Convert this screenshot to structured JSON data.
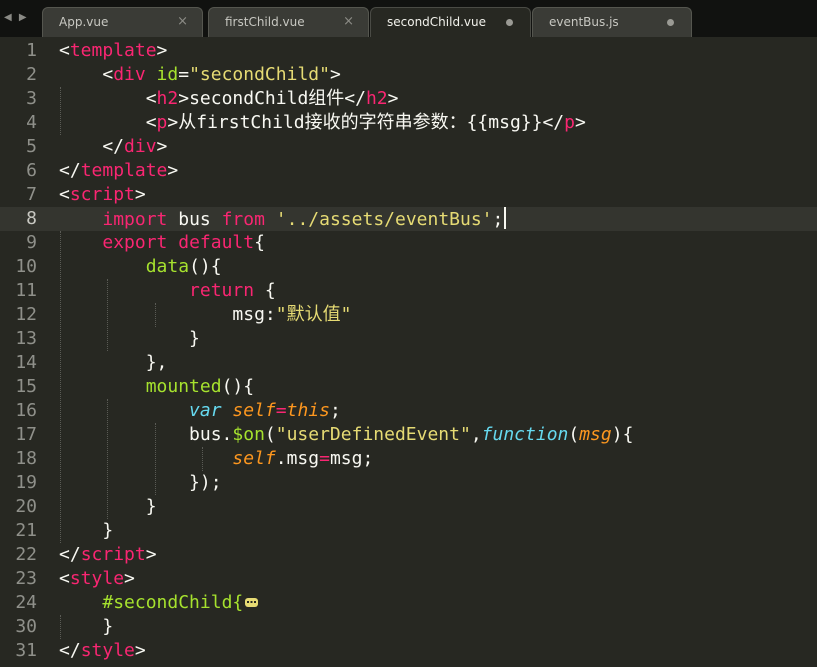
{
  "tabs": [
    {
      "label": "App.vue",
      "state": "close"
    },
    {
      "label": "firstChild.vue",
      "state": "close"
    },
    {
      "label": "secondChild.vue",
      "state": "modified"
    },
    {
      "label": "eventBus.js",
      "state": "modified"
    }
  ],
  "tab_close_glyph": "×",
  "nav_arrows": "◀ ▶",
  "lines": [
    {
      "no": "1",
      "tokens": [
        {
          "t": "<"
        },
        {
          "t": "template",
          "c": "t-tag"
        },
        {
          "t": ">"
        }
      ]
    },
    {
      "no": "2",
      "tokens": [
        {
          "t": "    <"
        },
        {
          "t": "div",
          "c": "t-tag"
        },
        {
          "t": " "
        },
        {
          "t": "id",
          "c": "t-attr"
        },
        {
          "t": "="
        },
        {
          "t": "\"secondChild\"",
          "c": "t-str"
        },
        {
          "t": ">"
        }
      ]
    },
    {
      "no": "3",
      "tokens": [
        {
          "t": "        <"
        },
        {
          "t": "h2",
          "c": "t-tag"
        },
        {
          "t": ">secondChild组件</"
        },
        {
          "t": "h2",
          "c": "t-tag"
        },
        {
          "t": ">"
        }
      ]
    },
    {
      "no": "4",
      "tokens": [
        {
          "t": "        <"
        },
        {
          "t": "p",
          "c": "t-tag"
        },
        {
          "t": ">从firstChild接收的字符串参数：{{msg}}</"
        },
        {
          "t": "p",
          "c": "t-tag"
        },
        {
          "t": ">"
        }
      ]
    },
    {
      "no": "5",
      "tokens": [
        {
          "t": "    </"
        },
        {
          "t": "div",
          "c": "t-tag"
        },
        {
          "t": ">"
        }
      ]
    },
    {
      "no": "6",
      "tokens": [
        {
          "t": "</"
        },
        {
          "t": "template",
          "c": "t-tag"
        },
        {
          "t": ">"
        }
      ]
    },
    {
      "no": "7",
      "tokens": [
        {
          "t": "<"
        },
        {
          "t": "script",
          "c": "t-tag"
        },
        {
          "t": ">"
        }
      ]
    },
    {
      "no": "8",
      "tokens": [
        {
          "t": "    "
        },
        {
          "t": "import",
          "c": "t-kw"
        },
        {
          "t": " bus "
        },
        {
          "t": "from",
          "c": "t-kw"
        },
        {
          "t": " "
        },
        {
          "t": "'../assets/eventBus'",
          "c": "t-str"
        },
        {
          "t": ";"
        }
      ],
      "current": true
    },
    {
      "no": "9",
      "tokens": [
        {
          "t": "    "
        },
        {
          "t": "export",
          "c": "t-kw"
        },
        {
          "t": " "
        },
        {
          "t": "default",
          "c": "t-kw"
        },
        {
          "t": "{"
        }
      ]
    },
    {
      "no": "10",
      "tokens": [
        {
          "t": "        "
        },
        {
          "t": "data",
          "c": "t-fn"
        },
        {
          "t": "(){"
        }
      ]
    },
    {
      "no": "11",
      "tokens": [
        {
          "t": "            "
        },
        {
          "t": "return",
          "c": "t-kw"
        },
        {
          "t": " {"
        }
      ]
    },
    {
      "no": "12",
      "tokens": [
        {
          "t": "                msg:"
        },
        {
          "t": "\"默认值\"",
          "c": "t-str"
        }
      ]
    },
    {
      "no": "13",
      "tokens": [
        {
          "t": "            }"
        }
      ]
    },
    {
      "no": "14",
      "tokens": [
        {
          "t": "        },"
        }
      ]
    },
    {
      "no": "15",
      "tokens": [
        {
          "t": "        "
        },
        {
          "t": "mounted",
          "c": "t-fn"
        },
        {
          "t": "(){"
        }
      ]
    },
    {
      "no": "16",
      "tokens": [
        {
          "t": "            "
        },
        {
          "t": "var",
          "c": "t-typ"
        },
        {
          "t": " "
        },
        {
          "t": "self",
          "c": "t-var"
        },
        {
          "t": "=",
          "c": "t-kw"
        },
        {
          "t": "this",
          "c": "t-var"
        },
        {
          "t": ";"
        }
      ]
    },
    {
      "no": "17",
      "tokens": [
        {
          "t": "            bus."
        },
        {
          "t": "$on",
          "c": "t-fn"
        },
        {
          "t": "("
        },
        {
          "t": "\"userDefinedEvent\"",
          "c": "t-str"
        },
        {
          "t": ","
        },
        {
          "t": "function",
          "c": "t-typ"
        },
        {
          "t": "("
        },
        {
          "t": "msg",
          "c": "t-var"
        },
        {
          "t": "){"
        }
      ]
    },
    {
      "no": "18",
      "tokens": [
        {
          "t": "                "
        },
        {
          "t": "self",
          "c": "t-var"
        },
        {
          "t": ".msg"
        },
        {
          "t": "=",
          "c": "t-kw"
        },
        {
          "t": "msg;"
        }
      ]
    },
    {
      "no": "19",
      "tokens": [
        {
          "t": "            });"
        }
      ]
    },
    {
      "no": "20",
      "tokens": [
        {
          "t": "        }"
        }
      ]
    },
    {
      "no": "21",
      "tokens": [
        {
          "t": "    }"
        }
      ]
    },
    {
      "no": "22",
      "tokens": [
        {
          "t": "</"
        },
        {
          "t": "script",
          "c": "t-tag"
        },
        {
          "t": ">"
        }
      ]
    },
    {
      "no": "23",
      "tokens": [
        {
          "t": "<"
        },
        {
          "t": "style",
          "c": "t-tag"
        },
        {
          "t": ">"
        }
      ]
    },
    {
      "no": "24",
      "tokens": [
        {
          "t": "    "
        },
        {
          "t": "#secondChild{",
          "c": "t-fn"
        }
      ],
      "fold": true
    },
    {
      "no": "30",
      "tokens": [
        {
          "t": "    }"
        }
      ]
    },
    {
      "no": "31",
      "tokens": [
        {
          "t": "</"
        },
        {
          "t": "style",
          "c": "t-tag"
        },
        {
          "t": ">"
        }
      ]
    }
  ]
}
